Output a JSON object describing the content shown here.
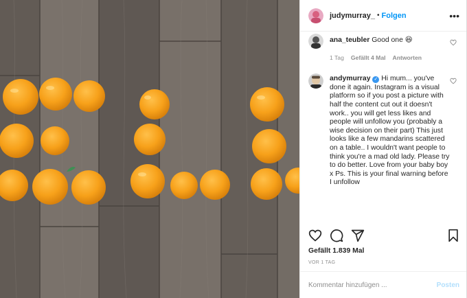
{
  "header": {
    "username": "judymurray_",
    "separator": "•",
    "follow_label": "Folgen",
    "more_glyph": "•••"
  },
  "comments": [
    {
      "username": "ana_teubler",
      "text": "Good one 😆",
      "time": "1 Tag",
      "likes": "Gefällt 4 Mal",
      "reply": "Antworten"
    },
    {
      "username": "andymurray",
      "verified": true,
      "text": "Hi mum... you've done it again. Instagram is a visual platform so if you post a picture with half the content cut out it doesn't work.. you will get less likes and people will unfollow you (probably a wise decision on their part) This just looks like a few mandarins scattered on a table.. I wouldn't want people to think you're a mad old lady. Please try to do better. Love from your baby boy x Ps. This is your final warning before I unfollow"
    }
  ],
  "post": {
    "likes": "Gefällt 1.839 Mal",
    "date": "VOR 1 TAG"
  },
  "comment_input": {
    "placeholder": "Kommentar hinzufügen ...",
    "post_label": "Posten"
  },
  "colors": {
    "link": "#0095f6",
    "post_disabled": "#b2dffc",
    "orange": "#f7a11a",
    "floor": "#6e6760"
  },
  "icons": [
    "heart-icon",
    "comment-icon",
    "share-icon",
    "bookmark-icon",
    "verified-icon",
    "more-icon"
  ]
}
